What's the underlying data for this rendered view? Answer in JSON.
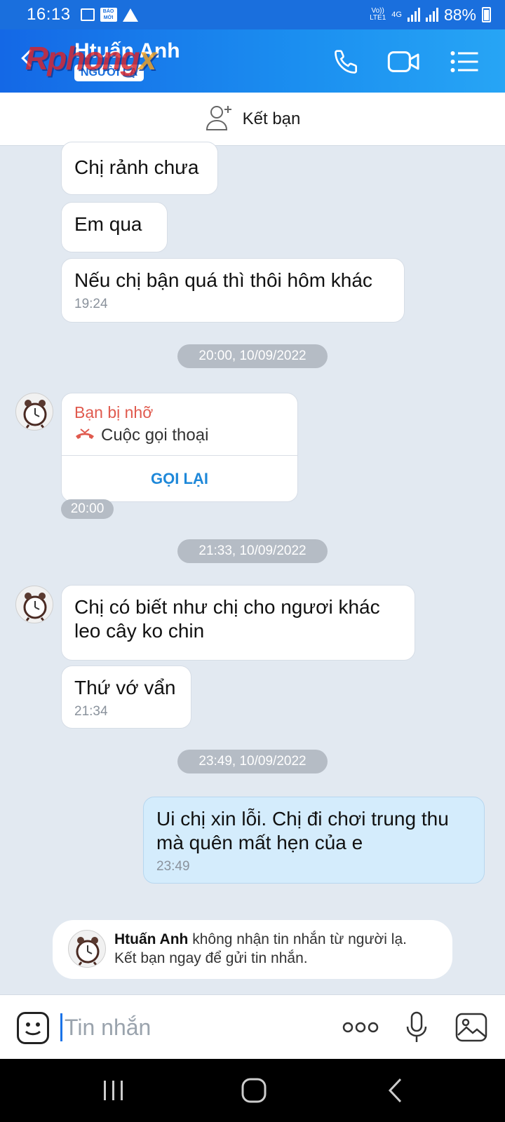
{
  "status_bar": {
    "time": "16:13",
    "network_top": "Vo))",
    "network_bottom": "LTE1",
    "network_type": "4G",
    "battery": "88%",
    "news_icon_text": "BÁO MỚI",
    "icons": [
      "image-icon",
      "news-icon",
      "warning-icon",
      "signal-icon",
      "battery-icon"
    ]
  },
  "header": {
    "contact_name": "Htuấn Anh",
    "badge": "NGƯỜI LẠ",
    "watermark_main": "Rphong",
    "watermark_accent": "x",
    "actions": [
      "phone-icon",
      "video-call-icon",
      "menu-list-icon"
    ]
  },
  "friend_bar": {
    "label": "Kết bạn"
  },
  "messages": [
    {
      "text": "Chị rảnh chưa"
    },
    {
      "text": "Em qua"
    },
    {
      "text": "Nếu chị bận quá thì thôi hôm khác",
      "time": "19:24"
    }
  ],
  "separators": [
    "20:00, 10/09/2022",
    "21:33, 10/09/2022",
    "23:49, 10/09/2022"
  ],
  "missed_call": {
    "title": "Bạn bị nhỡ",
    "subtitle": "Cuộc gọi thoại",
    "action": "GỌI LẠI",
    "time": "20:00"
  },
  "messages2": [
    {
      "text": "Chị có biết như chị cho ngươi khác leo cây ko chin"
    },
    {
      "text": "Thứ vớ vẩn",
      "time": "21:34"
    }
  ],
  "my_message": {
    "text": "Ui chị xin lỗi. Chị đi chơi trung thu mà quên mất hẹn của e",
    "time": "23:49"
  },
  "notice": {
    "name": "Htuấn Anh",
    "line1_rest": " không nhận tin nhắn từ người lạ.",
    "line2": "Kết bạn ngay để gửi tin nhắn."
  },
  "input": {
    "placeholder": "Tin nhắn"
  },
  "colors": {
    "brand_blue": "#1a6fdd",
    "my_bubble": "#d4ecfc",
    "missed_red": "#e05a4e",
    "callback_blue": "#1e88d9"
  }
}
